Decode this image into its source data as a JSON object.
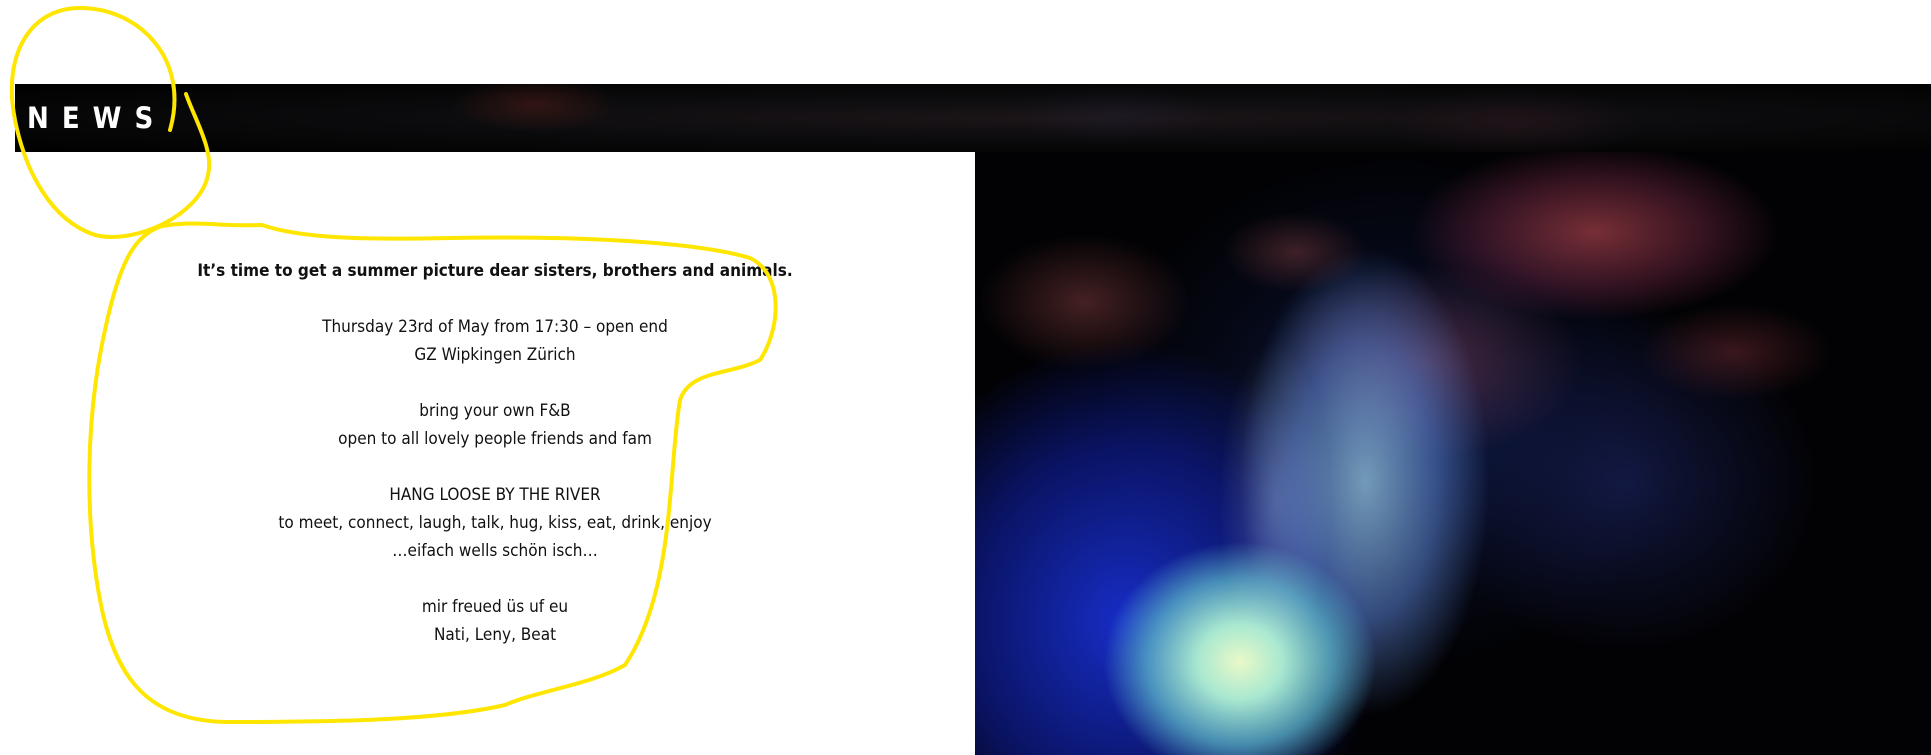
{
  "news_section": {
    "title": "NEWS"
  },
  "post": {
    "lead": "It’s time to get a summer picture dear sisters, brothers and animals.",
    "when": "Thursday 23rd of May from 17:30 – open end",
    "where": "GZ Wipkingen Zürich",
    "bring": "bring your own F&B",
    "open_to": "open to all lovely people friends and fam",
    "headline": "HANG LOOSE BY THE RIVER",
    "activities": "to meet, connect, laugh, talk, hug, kiss, eat, drink, enjoy",
    "tagline": "…eifach wells schön isch…",
    "closing": "mir freued üs uf eu",
    "signature": "Nati, Leny, Beat"
  },
  "annotation": {
    "color": "#ffe600"
  },
  "hero_image": {
    "palette": [
      "#1a2fd8",
      "#a8e8d0",
      "#b0475a",
      "#050816"
    ]
  }
}
